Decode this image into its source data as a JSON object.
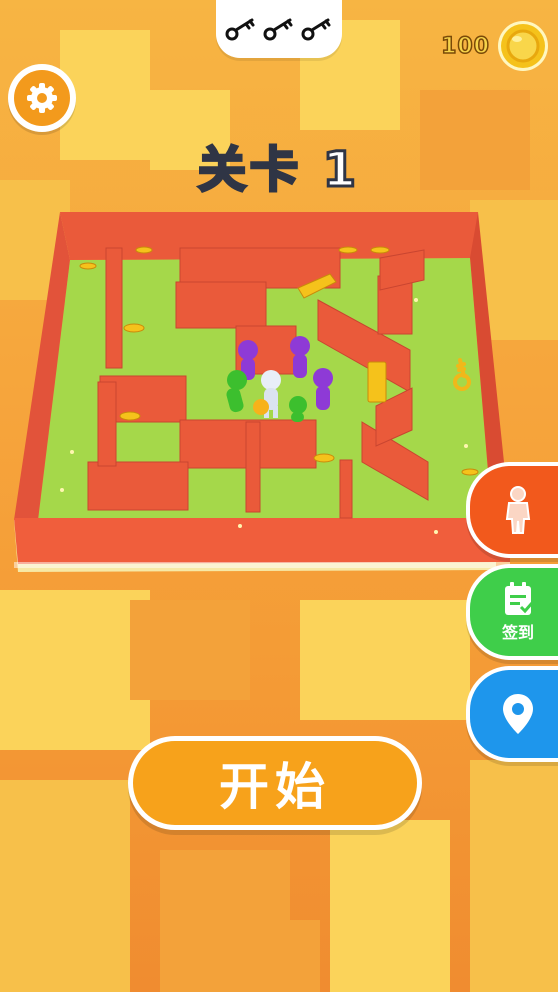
{
  "hud": {
    "keys_collected": 3,
    "keys_total": 3,
    "coin_count": "100"
  },
  "level": {
    "title": "关卡 1"
  },
  "side_buttons": {
    "checkin_label": "签到"
  },
  "start_button": {
    "label": "开始"
  },
  "icons": {
    "settings": "gear-icon",
    "key": "key-icon",
    "coin": "coin-icon",
    "character": "character-icon",
    "checkin": "calendar-check-icon",
    "location": "location-pin-icon"
  },
  "colors": {
    "background": "#f6a03a",
    "wall": "#ea5a3a",
    "floor": "#a5d84a",
    "settings": "#f39a1c",
    "character_button": "#f2591c",
    "checkin_button": "#3fce4a",
    "location_button": "#1e96ec",
    "start_button": "#f7a21b"
  }
}
